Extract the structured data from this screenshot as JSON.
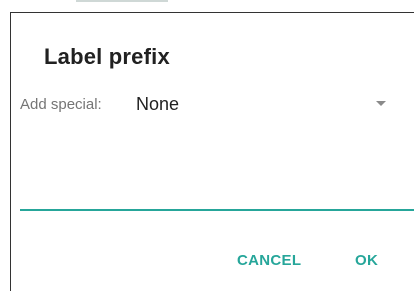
{
  "dialog": {
    "title": "Label prefix",
    "add_special_label": "Add special:",
    "add_special_value": "None",
    "dropdown_icon": "triangle-down-icon",
    "buttons": {
      "cancel": "CANCEL",
      "ok": "OK"
    }
  },
  "colors": {
    "accent": "#26a69a",
    "title_text": "#212121",
    "label_text": "#757575",
    "arrow": "#8a8a8a"
  }
}
